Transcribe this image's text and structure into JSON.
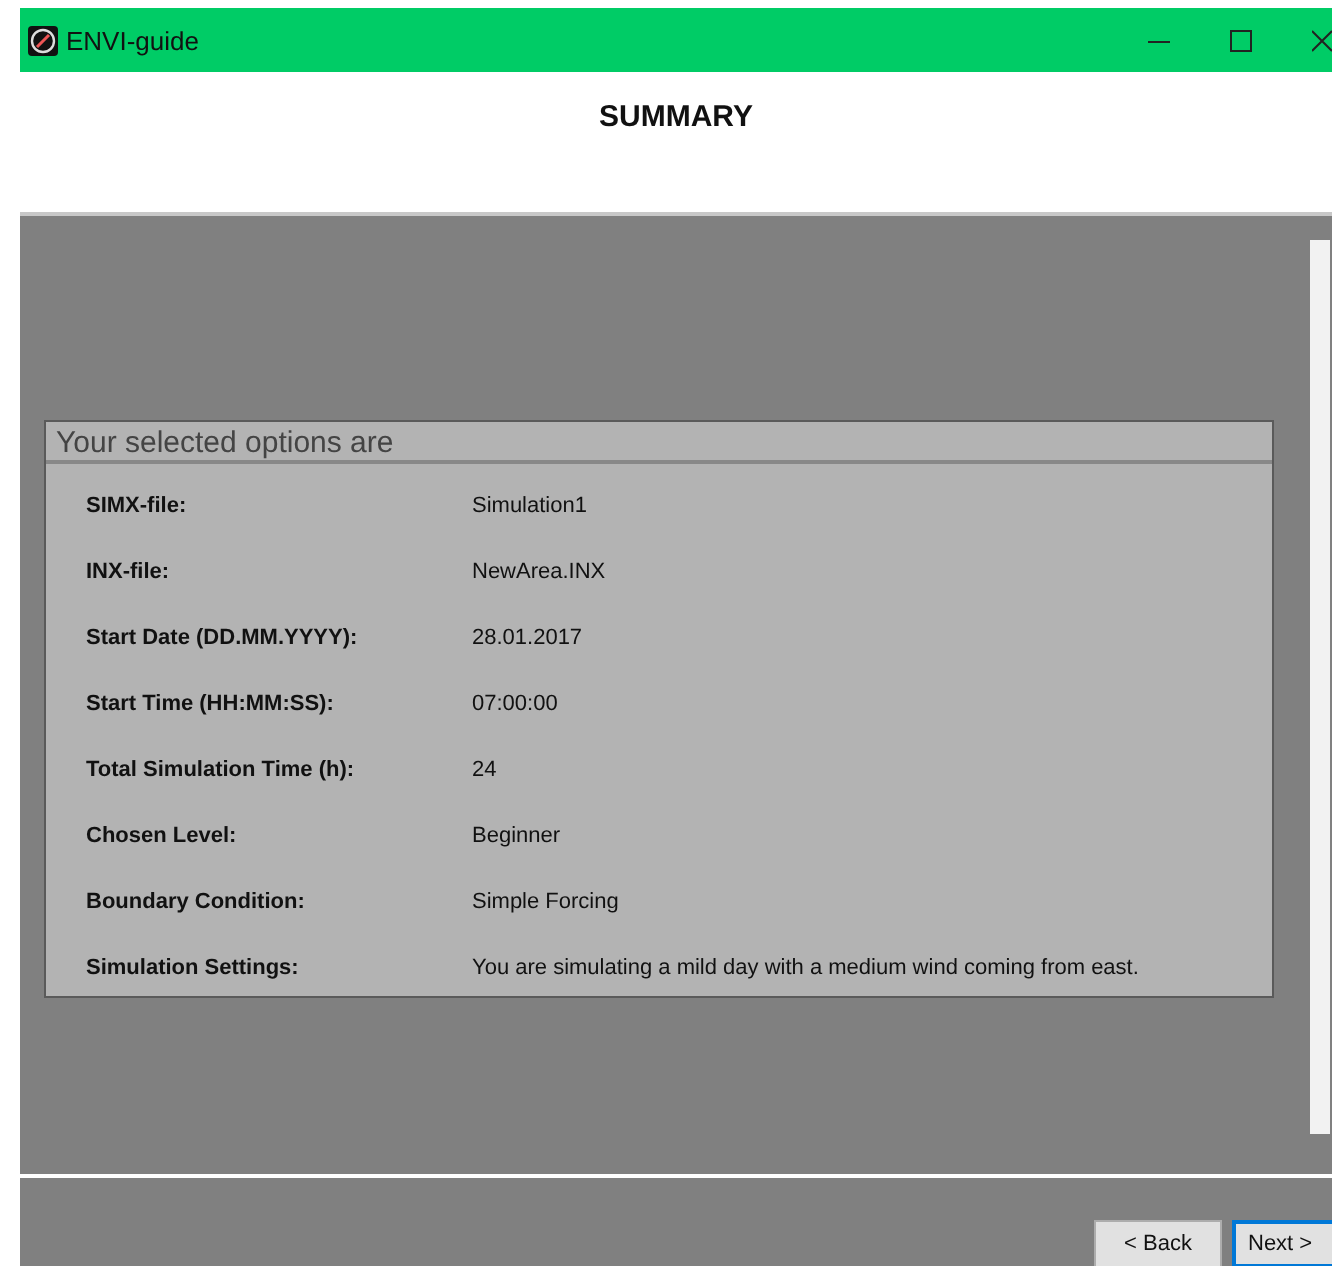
{
  "window": {
    "title": "ENVI-guide"
  },
  "header": {
    "title": "SUMMARY"
  },
  "group": {
    "title": "Your selected options are",
    "rows": [
      {
        "label": "SIMX-file:",
        "value": "Simulation1"
      },
      {
        "label": "INX-file:",
        "value": "NewArea.INX"
      },
      {
        "label": "Start Date (DD.MM.YYYY):",
        "value": "28.01.2017"
      },
      {
        "label": "Start Time (HH:MM:SS):",
        "value": "07:00:00"
      },
      {
        "label": "Total Simulation Time (h):",
        "value": "24"
      },
      {
        "label": "Chosen Level:",
        "value": "Beginner"
      },
      {
        "label": "Boundary Condition:",
        "value": "Simple Forcing"
      },
      {
        "label": "Simulation Settings:",
        "value": "You are simulating a mild day with a medium wind coming from east."
      }
    ]
  },
  "buttons": [
    {
      "label": "< Back",
      "focused": false
    },
    {
      "label": "Next >",
      "focused": true
    }
  ]
}
